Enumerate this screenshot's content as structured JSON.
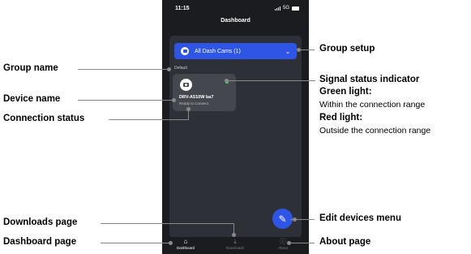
{
  "status_bar": {
    "time": "11:15",
    "network": "5G"
  },
  "header": {
    "title": "Dashboard"
  },
  "group_button": {
    "label": "All Dash Cams (1)",
    "icon": "camera-icon",
    "chevron": "chevron-down-icon"
  },
  "group": {
    "name": "Default"
  },
  "device": {
    "name": "DRV-A510W ba7",
    "status": "Ready to Connect",
    "signal_color": "#3ddc6a"
  },
  "fab": {
    "icon": "pencil-icon"
  },
  "nav": [
    {
      "label": "Dashboard",
      "icon": "home-icon"
    },
    {
      "label": "Downloads",
      "icon": "download-icon"
    },
    {
      "label": "About",
      "icon": "info-icon"
    }
  ],
  "callouts": {
    "group_setup": "Group setup",
    "group_name": "Group name",
    "signal_title": "Signal status indicator",
    "green_title": "Green light:",
    "green_desc": "Within the connection range",
    "red_title": "Red light:",
    "red_desc": "Outside the connection range",
    "device_name": "Device name",
    "connection_status": "Connection status",
    "edit_devices": "Edit devices menu",
    "downloads_page": "Downloads page",
    "dashboard_page": "Dashboard page",
    "about_page": "About page"
  },
  "colors": {
    "accent": "#2f55e6",
    "background": "#1b1c20",
    "panel": "#2e3038",
    "card": "#45474e"
  }
}
